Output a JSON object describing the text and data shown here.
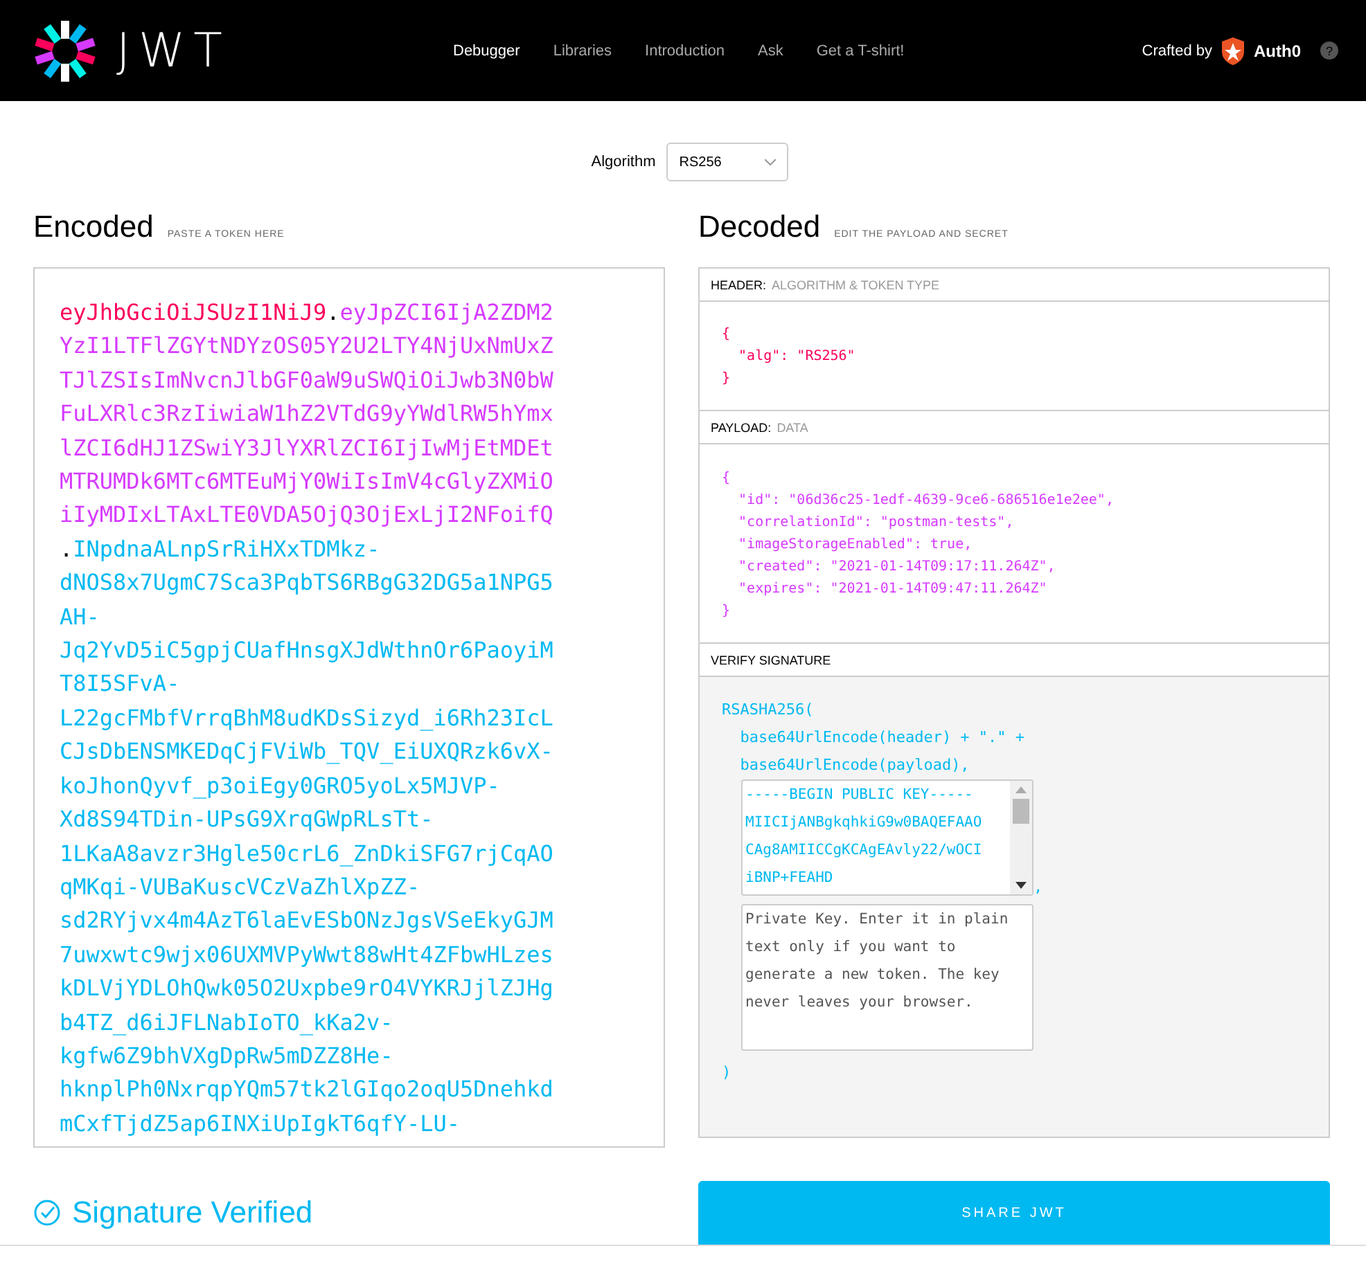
{
  "topbar": {
    "logo_text": "JWT",
    "nav": [
      {
        "label": "Debugger",
        "selected": true
      },
      {
        "label": "Libraries",
        "selected": false
      },
      {
        "label": "Introduction",
        "selected": false
      },
      {
        "label": "Ask",
        "selected": false
      },
      {
        "label": "Get a T-shirt!",
        "selected": false
      }
    ],
    "crafted_by": "Crafted by",
    "brand": "Auth0",
    "help": "?"
  },
  "algorithm": {
    "label": "Algorithm",
    "value": "RS256"
  },
  "encoded": {
    "title": "Encoded",
    "subtitle": "PASTE A TOKEN HERE",
    "lines": [
      [
        {
          "kind": "header",
          "text": "eyJhbGciOiJSUzI1NiJ9"
        },
        {
          "kind": "dot",
          "text": "."
        },
        {
          "kind": "payload",
          "text": "eyJpZCI6IjA2ZDM2"
        }
      ],
      [
        {
          "kind": "payload",
          "text": "YzI1LTFlZGYtNDYzOS05Y2U2LTY4NjUxNmUxZ"
        }
      ],
      [
        {
          "kind": "payload",
          "text": "TJlZSIsImNvcnJlbGF0aW9uSWQiOiJwb3N0bW"
        }
      ],
      [
        {
          "kind": "payload",
          "text": "FuLXRlc3RzIiwiaW1hZ2VTdG9yYWdlRW5hYmx"
        }
      ],
      [
        {
          "kind": "payload",
          "text": "lZCI6dHJ1ZSwiY3JlYXRlZCI6IjIwMjEtMDEt"
        }
      ],
      [
        {
          "kind": "payload",
          "text": "MTRUMDk6MTc6MTEuMjY0WiIsImV4cGlyZXMiO"
        }
      ],
      [
        {
          "kind": "payload",
          "text": "iIyMDIxLTAxLTE0VDA5OjQ3OjExLjI2NFoifQ"
        }
      ],
      [
        {
          "kind": "dot",
          "text": "."
        },
        {
          "kind": "signature",
          "text": "INpdnaALnpSrRiHXxTDMkz-"
        }
      ],
      [
        {
          "kind": "signature",
          "text": "dNOS8x7UgmC7Sca3PqbTS6RBgG32DG5a1NPG5"
        }
      ],
      [
        {
          "kind": "signature",
          "text": "AH-"
        }
      ],
      [
        {
          "kind": "signature",
          "text": "Jq2YvD5iC5gpjCUafHnsgXJdWthnOr6PaoyiM"
        }
      ],
      [
        {
          "kind": "signature",
          "text": "T8I5SFvA-"
        }
      ],
      [
        {
          "kind": "signature",
          "text": "L22gcFMbfVrrqBhM8udKDsSizyd_i6Rh23IcL"
        }
      ],
      [
        {
          "kind": "signature",
          "text": "CJsDbENSMKEDqCjFViWb_TQV_EiUXQRzk6vX-"
        }
      ],
      [
        {
          "kind": "signature",
          "text": "koJhonQyvf_p3oiEgy0GRO5yoLx5MJVP-"
        }
      ],
      [
        {
          "kind": "signature",
          "text": "Xd8S94TDin-UPsG9XrqGWpRLsTt-"
        }
      ],
      [
        {
          "kind": "signature",
          "text": "1LKaA8avzr3Hgle50crL6_ZnDkiSFG7rjCqAO"
        }
      ],
      [
        {
          "kind": "signature",
          "text": "qMKqi-VUBaKuscVCzVaZhlXpZZ-"
        }
      ],
      [
        {
          "kind": "signature",
          "text": "sd2RYjvx4m4AzT6laEvESbONzJgsVSeEkyGJM"
        }
      ],
      [
        {
          "kind": "signature",
          "text": "7uwxwtc9wjx06UXMVPyWwt88wHt4ZFbwHLzes"
        }
      ],
      [
        {
          "kind": "signature",
          "text": "kDLVjYDLOhQwk05O2Uxpbe9rO4VYKRJjlZJHg"
        }
      ],
      [
        {
          "kind": "signature",
          "text": "b4TZ_d6iJFLNabIoTO_kKa2v-"
        }
      ],
      [
        {
          "kind": "signature",
          "text": "kgfw6Z9bhVXgDpRw5mDZZ8He-"
        }
      ],
      [
        {
          "kind": "signature",
          "text": "hknplPh0NxrqpYQm57tk2lGIqo2oqU5Dnehkd"
        }
      ],
      [
        {
          "kind": "signature",
          "text": "mCxfTjdZ5ap6INXiUpIgkT6qfY-LU-"
        }
      ]
    ]
  },
  "decoded": {
    "title": "Decoded",
    "subtitle": "EDIT THE PAYLOAD AND SECRET",
    "header": {
      "label": "HEADER:",
      "sublabel": "ALGORITHM & TOKEN TYPE",
      "lines": [
        "{",
        "  \"alg\": \"RS256\"",
        "}"
      ]
    },
    "payload": {
      "label": "PAYLOAD:",
      "sublabel": "DATA",
      "lines": [
        "{",
        "  \"id\": \"06d36c25-1edf-4639-9ce6-686516e1e2ee\",",
        "  \"correlationId\": \"postman-tests\",",
        "  \"imageStorageEnabled\": true,",
        "  \"created\": \"2021-01-14T09:17:11.264Z\",",
        "  \"expires\": \"2021-01-14T09:47:11.264Z\"",
        "}"
      ]
    },
    "signature": {
      "label": "VERIFY SIGNATURE",
      "lines": [
        "RSASHA256(",
        "  base64UrlEncode(header) + \".\" +",
        "  base64UrlEncode(payload),"
      ],
      "public_key": [
        "-----BEGIN PUBLIC KEY-----",
        "MIICIjANBgkqhkiG9w0BAQEFAAO",
        "CAg8AMIICCgKCAgEAvly22/wOCI",
        "iBNP+FEAHD"
      ],
      "comma": ",",
      "private_key_placeholder": "Private Key. Enter it in plain text only if you want to generate a new token. The key never leaves your browser.",
      "closing": ")"
    }
  },
  "status": {
    "label": "Signature Verified",
    "verified": true
  },
  "share_button": "SHARE JWT"
}
